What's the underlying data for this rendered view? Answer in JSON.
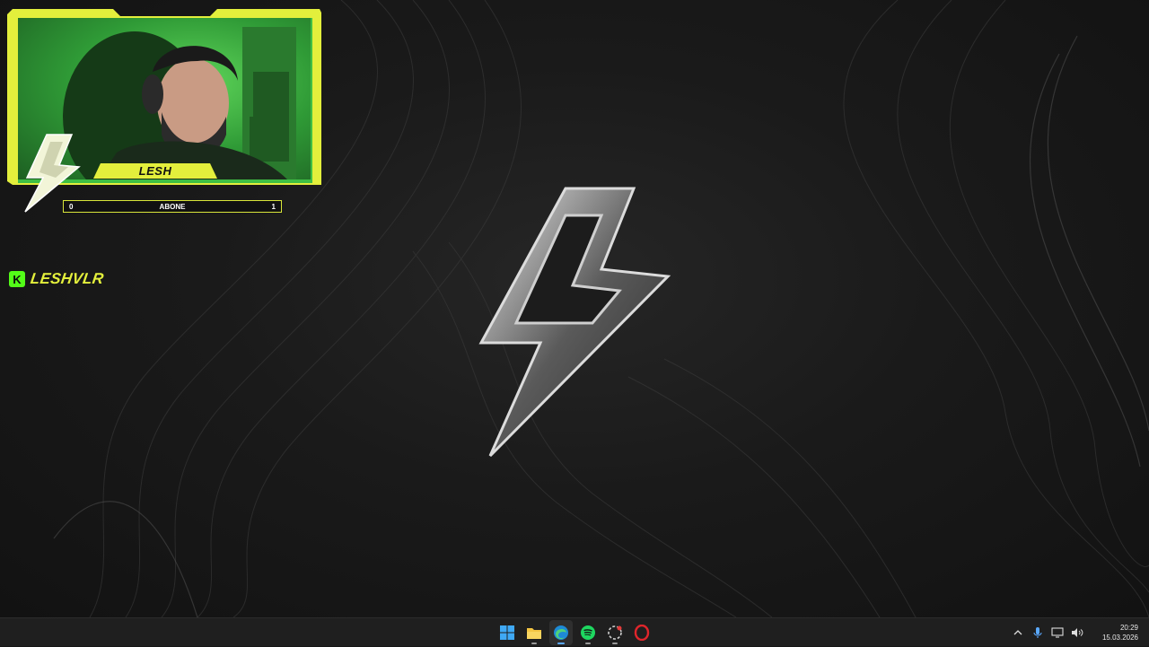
{
  "overlay": {
    "streamer_name": "LESH",
    "subscriber_goal": {
      "label": "ABONE",
      "current": "0",
      "target": "1",
      "progress": 0
    },
    "kick_username": "LESHVLR",
    "accent_color": "#e3ef3c",
    "kick_color": "#53fc18"
  },
  "taskbar": {
    "apps": [
      {
        "name": "start-button",
        "icon": "windows-icon"
      },
      {
        "name": "file-explorer",
        "icon": "folder-icon"
      },
      {
        "name": "edge",
        "icon": "edge-icon",
        "active": true
      },
      {
        "name": "spotify",
        "icon": "spotify-icon"
      },
      {
        "name": "app",
        "icon": "app-icon"
      },
      {
        "name": "opera",
        "icon": "opera-icon"
      }
    ],
    "tray": [
      "chevron-up-icon",
      "microphone-icon",
      "display-icon",
      "speaker-icon"
    ],
    "clock": {
      "time": "20:29",
      "date": "15.03.2026"
    }
  }
}
